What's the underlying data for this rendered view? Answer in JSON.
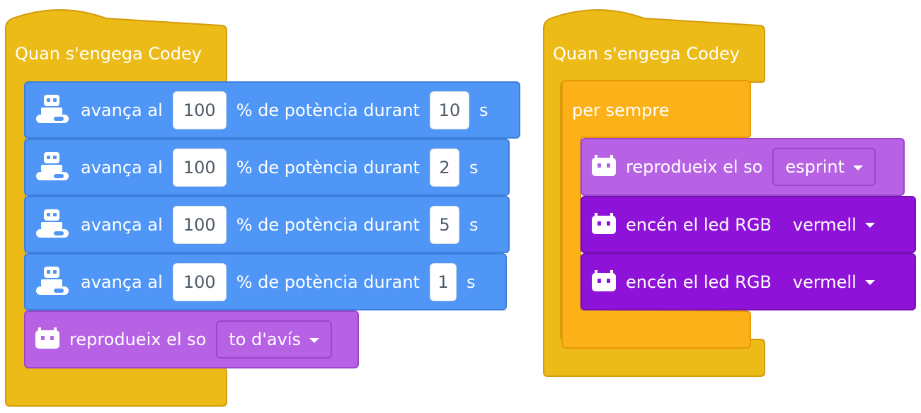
{
  "script_left": {
    "hat": {
      "label": "Quan s'engega Codey"
    },
    "blocks": [
      {
        "kind": "motion",
        "text_pre": "avança al",
        "power": "100",
        "text_mid": "% de potència durant",
        "duration": "10",
        "text_post": "s"
      },
      {
        "kind": "motion",
        "text_pre": "avança al",
        "power": "100",
        "text_mid": "% de potència durant",
        "duration": "2",
        "text_post": "s"
      },
      {
        "kind": "motion",
        "text_pre": "avança al",
        "power": "100",
        "text_mid": "% de potència durant",
        "duration": "5",
        "text_post": "s"
      },
      {
        "kind": "motion",
        "text_pre": "avança al",
        "power": "100",
        "text_mid": "% de potència durant",
        "duration": "1",
        "text_post": "s"
      },
      {
        "kind": "sound",
        "text_pre": "reprodueix el so",
        "sound": "to d'avís"
      }
    ]
  },
  "script_right": {
    "hat": {
      "label": "Quan s'engega Codey"
    },
    "loop": {
      "label": "per sempre"
    },
    "blocks": [
      {
        "kind": "sound",
        "text_pre": "reprodueix el so",
        "sound": "esprint"
      },
      {
        "kind": "led",
        "text_pre": "encén el led RGB",
        "color": "vermell"
      },
      {
        "kind": "led",
        "text_pre": "encén el led RGB",
        "color": "vermell"
      }
    ]
  },
  "colors": {
    "event": "#ecbb17",
    "control": "#fdb118",
    "motion": "#4f96f7",
    "sound": "#b761e5",
    "led": "#8f12d8"
  },
  "icons": {
    "motion": "rover-robot-icon",
    "codey": "codey-face-icon"
  }
}
